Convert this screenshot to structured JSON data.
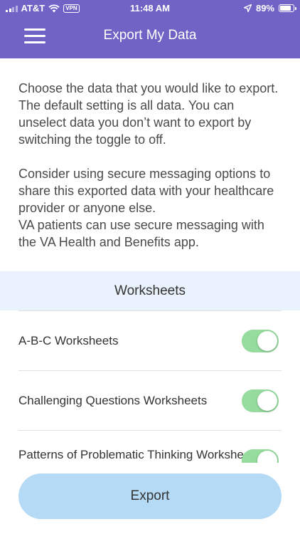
{
  "status_bar": {
    "carrier": "AT&T",
    "vpn": "VPN",
    "time": "11:48 AM",
    "battery": "89%"
  },
  "header": {
    "title": "Export My Data",
    "menu_icon": "hamburger-menu-icon"
  },
  "intro": {
    "paragraph1": "Choose the data that you would like to export. The default setting is all data. You can unselect data you don’t want to export by switching the toggle to off.",
    "paragraph2": "Consider using secure messaging options to share this exported data with your healthcare provider or anyone else.",
    "paragraph3": "VA patients can use secure messaging with the VA Health and Benefits app."
  },
  "section": {
    "title": "Worksheets"
  },
  "items": [
    {
      "label": "A-B-C Worksheets",
      "enabled": true
    },
    {
      "label": "Challenging Questions Worksheets",
      "enabled": true
    },
    {
      "label": "Patterns of Problematic Thinking Worksheets",
      "enabled": true
    }
  ],
  "export_button": {
    "label": "Export"
  },
  "colors": {
    "header_bg": "#6f63c6",
    "section_bg": "#eaf3fd",
    "toggle_on": "#96dc9e",
    "button_bg": "#b5daf6"
  }
}
